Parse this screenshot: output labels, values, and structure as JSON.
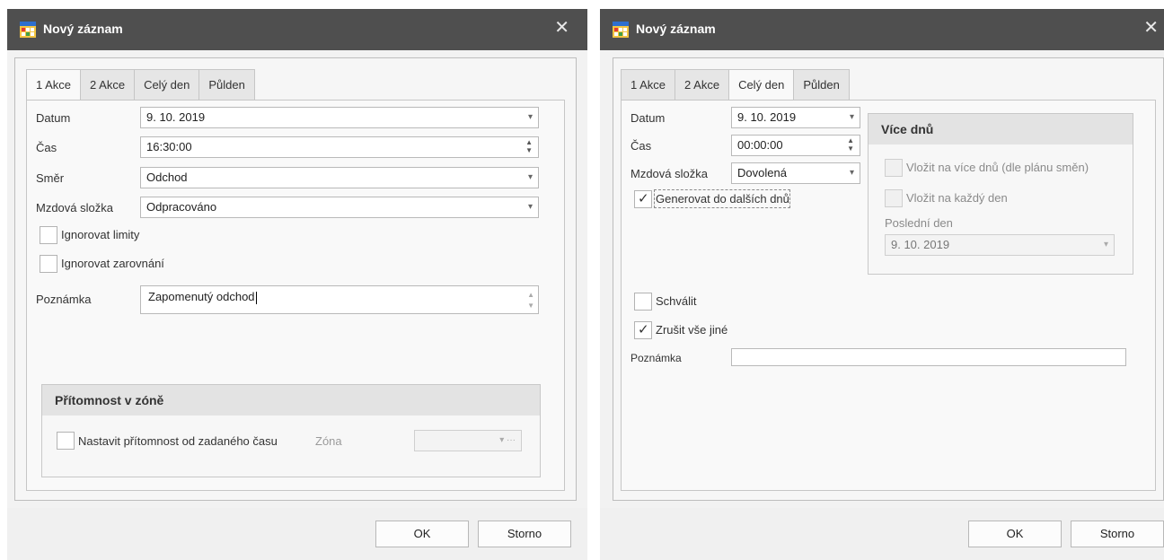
{
  "left_dialog": {
    "title": "Nový záznam",
    "close_glyph": "✕",
    "tabs": [
      "1 Akce",
      "2 Akce",
      "Celý den",
      "Půlden"
    ],
    "active_tab": "1 Akce",
    "fields": {
      "datum_label": "Datum",
      "datum_value": "9. 10. 2019",
      "cas_label": "Čas",
      "cas_value": "16:30:00",
      "smer_label": "Směr",
      "smer_value": "Odchod",
      "mzdova_label": "Mzdová složka",
      "mzdova_value": "Odpracováno"
    },
    "checkboxes": {
      "ignorovat_limity": {
        "label": "Ignorovat limity",
        "checked": false
      },
      "ignorovat_zarovnani": {
        "label": "Ignorovat zarovnání",
        "checked": false
      }
    },
    "poznamka_label": "Poznámka",
    "poznamka_value": "Zapomenutý odchod",
    "zone_group": {
      "title": "Přítomnost v zóně",
      "checkbox_label": "Nastavit přítomnost od zadaného času",
      "zona_label": "Zóna",
      "zona_value": ""
    },
    "ok_label": "OK",
    "cancel_label": "Storno"
  },
  "right_dialog": {
    "title": "Nový záznam",
    "close_glyph": "✕",
    "tabs": [
      "1 Akce",
      "2 Akce",
      "Celý den",
      "Půlden"
    ],
    "active_tab": "Celý den",
    "fields": {
      "datum_label": "Datum",
      "datum_value": "9. 10. 2019",
      "cas_label": "Čas",
      "cas_value": "00:00:00",
      "mzdova_label": "Mzdová složka",
      "mzdova_value": "Dovolená"
    },
    "generovat": {
      "label": "Generovat do dalších dnů",
      "checked": true
    },
    "vice_dnu": {
      "title": "Více dnů",
      "vlozit_plan": {
        "label": "Vložit na více dnů (dle plánu směn)",
        "checked": false
      },
      "vlozit_kazdy": {
        "label": "Vložit na každý den",
        "checked": false
      },
      "posledni_den_label": "Poslední den",
      "posledni_den_value": "9. 10. 2019"
    },
    "schvalit": {
      "label": "Schválit",
      "checked": false
    },
    "zrusit": {
      "label": "Zrušit vše jiné",
      "checked": true
    },
    "poznamka_label": "Poznámka",
    "poznamka_value": "",
    "ok_label": "OK",
    "cancel_label": "Storno"
  },
  "icons": {
    "app": "calendar-grid-icon",
    "dropdown": "▾",
    "spin": "▲▼",
    "check": "✓",
    "ellipsis": "···"
  },
  "colors": {
    "titlebar": "#4f4f4f",
    "dialog_bg": "#f2f2f2",
    "group_header": "#e3e3e3"
  }
}
